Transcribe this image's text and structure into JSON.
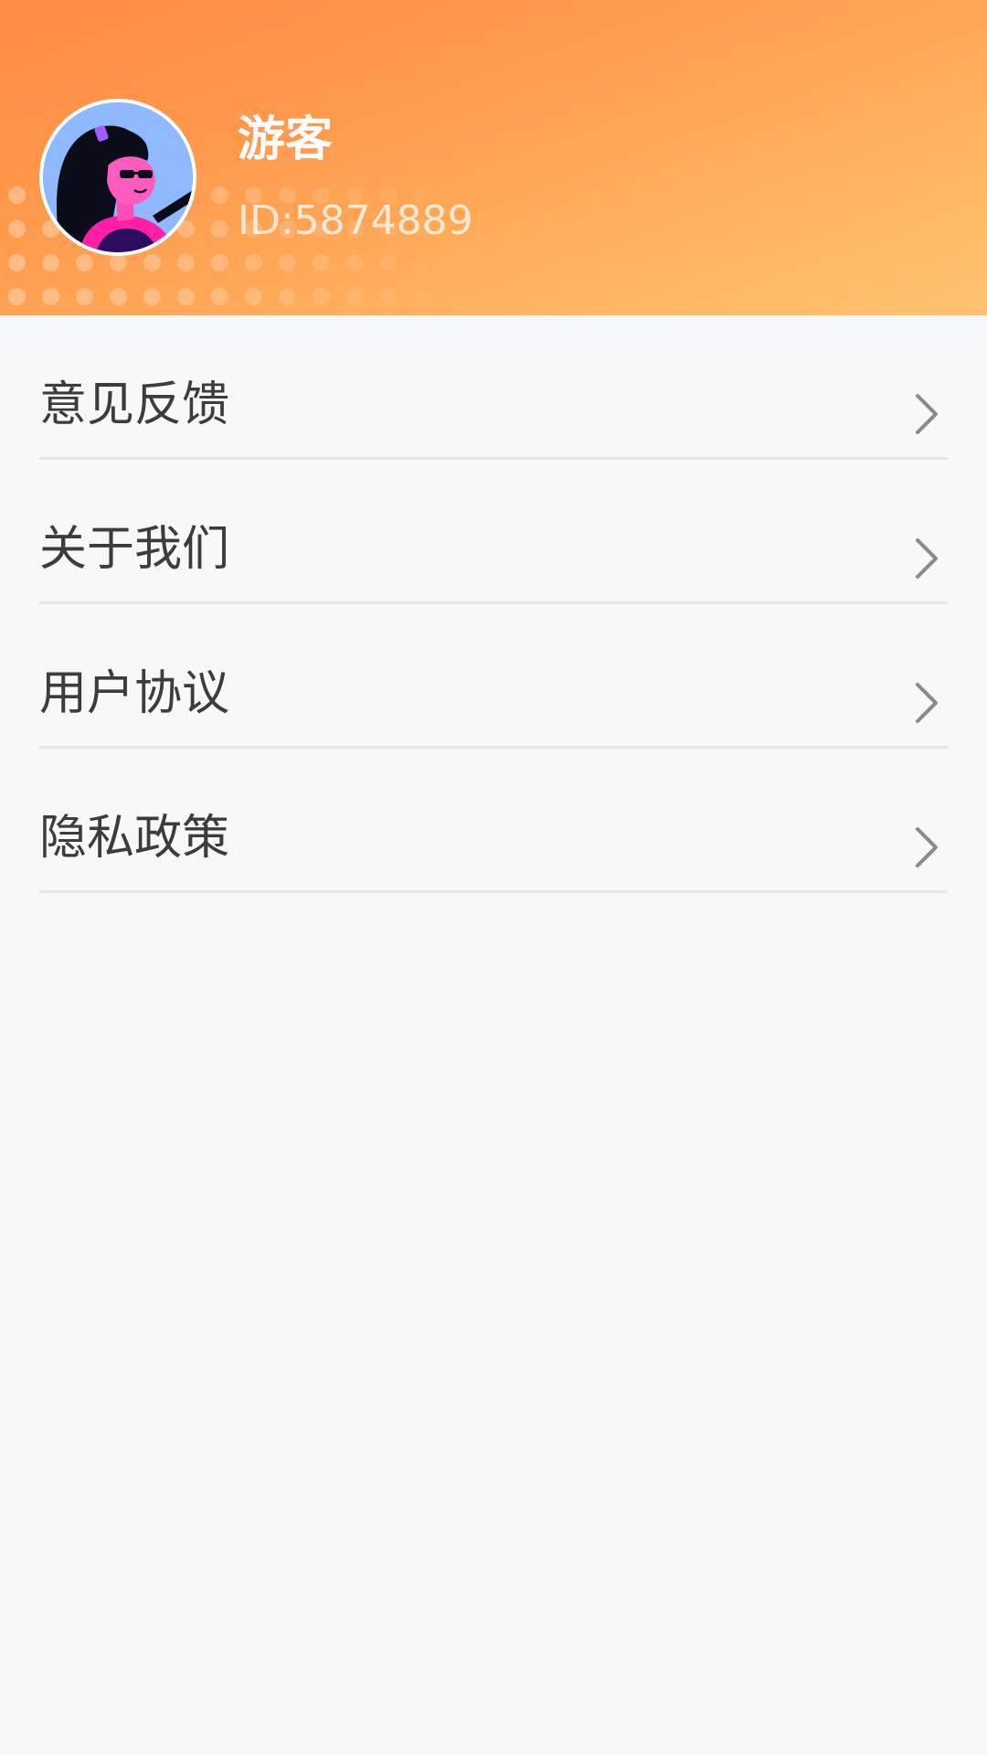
{
  "profile": {
    "name": "游客",
    "id_text": "ID:5874889",
    "avatar": "avatar-illustration"
  },
  "menu": {
    "items": [
      {
        "label": "意见反馈",
        "icon": "chevron-right-icon"
      },
      {
        "label": "关于我们",
        "icon": "chevron-right-icon"
      },
      {
        "label": "用户协议",
        "icon": "chevron-right-icon"
      },
      {
        "label": "隐私政策",
        "icon": "chevron-right-icon"
      }
    ]
  },
  "colors": {
    "header_gradient_start": "#ff8a42",
    "header_gradient_end": "#ffc26f",
    "background": "#f7f8fc",
    "divider": "#e4e6ec",
    "text": "#3c3c3c"
  }
}
